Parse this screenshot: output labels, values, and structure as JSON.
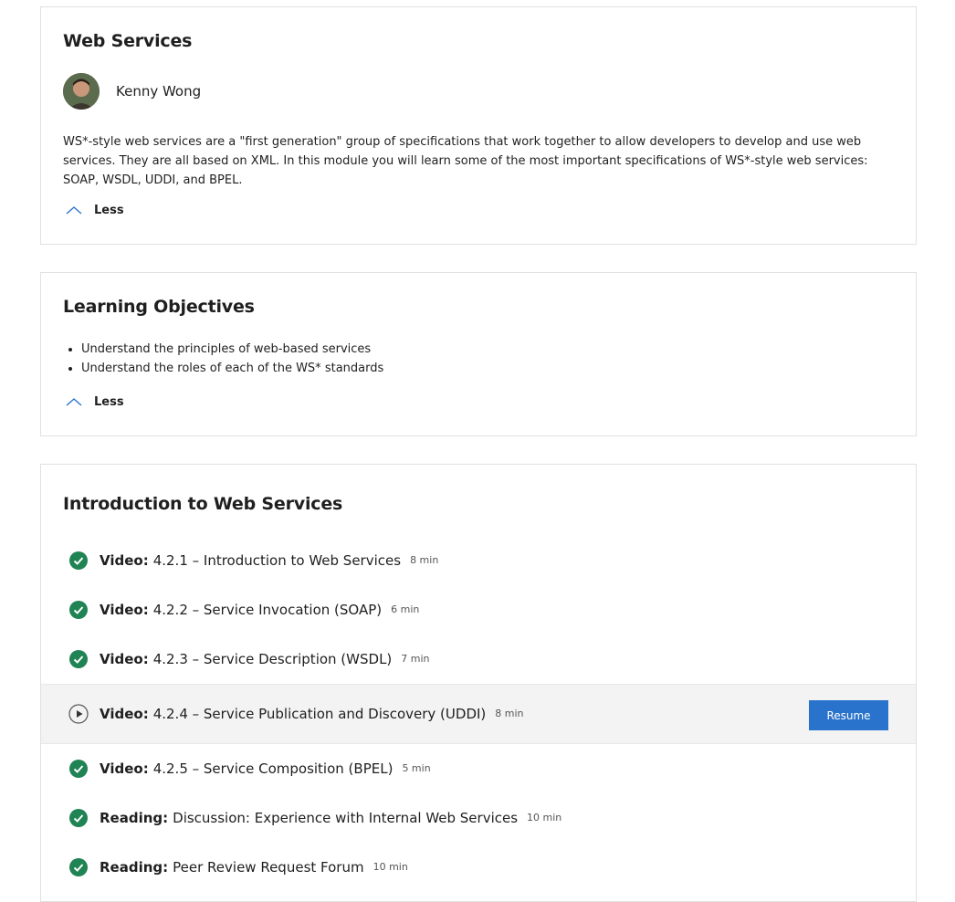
{
  "module": {
    "title": "Web Services",
    "instructor": {
      "name": "Kenny Wong"
    },
    "description": "WS*-style web services are a \"first generation\" group of specifications that work together to allow developers to develop and use web services. They are all based on XML. In this module you will learn some of the most important specifications of WS*-style web services: SOAP, WSDL, UDDI, and BPEL.",
    "toggle_label": "Less"
  },
  "objectives": {
    "title": "Learning Objectives",
    "items": [
      "Understand the principles of web-based services",
      "Understand the roles of each of the WS* standards"
    ],
    "toggle_label": "Less"
  },
  "lessons": {
    "title": "Introduction to Web Services",
    "items": [
      {
        "type": "Video:",
        "title": "4.2.1 – Introduction to Web Services",
        "duration": "8 min",
        "status": "completed"
      },
      {
        "type": "Video:",
        "title": "4.2.2 – Service Invocation (SOAP)",
        "duration": "6 min",
        "status": "completed"
      },
      {
        "type": "Video:",
        "title": "4.2.3 – Service Description (WSDL)",
        "duration": "7 min",
        "status": "completed"
      },
      {
        "type": "Video:",
        "title": "4.2.4 – Service Publication and Discovery (UDDI)",
        "duration": "8 min",
        "status": "in-progress"
      },
      {
        "type": "Video:",
        "title": "4.2.5 – Service Composition (BPEL)",
        "duration": "5 min",
        "status": "completed"
      },
      {
        "type": "Reading:",
        "title": "Discussion: Experience with Internal Web Services",
        "duration": "10 min",
        "status": "completed"
      },
      {
        "type": "Reading:",
        "title": "Peer Review Request Forum",
        "duration": "10 min",
        "status": "completed"
      }
    ],
    "resume_label": "Resume"
  },
  "colors": {
    "completed_green": "#1f8354",
    "accent_blue": "#2a73cc"
  },
  "icons": {
    "completed": "check-circle-icon",
    "in_progress": "play-circle-icon",
    "toggle": "chevron-up-icon"
  }
}
